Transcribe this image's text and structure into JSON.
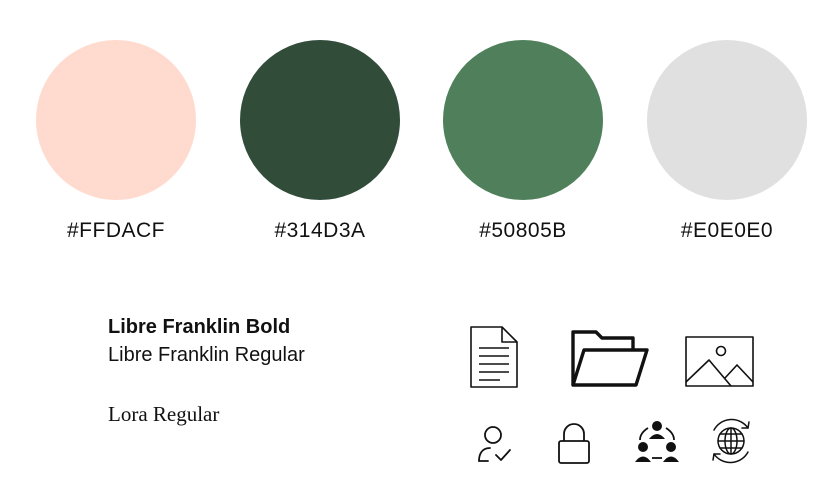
{
  "palette": {
    "swatches": [
      {
        "hex_label": "#FFDACF",
        "color": "#FFDACF"
      },
      {
        "hex_label": "#314D3A",
        "color": "#314D3A"
      },
      {
        "hex_label": "#50805B",
        "color": "#50805B"
      },
      {
        "hex_label": "#E0E0E0",
        "color": "#E0E0E0"
      }
    ]
  },
  "typography": {
    "samples": [
      {
        "label": "Libre Franklin Bold"
      },
      {
        "label": "Libre Franklin Regular"
      },
      {
        "label": "Lora Regular"
      }
    ]
  },
  "icons": [
    "document-icon",
    "folder-open-icon",
    "image-icon",
    "user-check-icon",
    "lock-icon",
    "team-network-icon",
    "globe-sync-icon"
  ]
}
